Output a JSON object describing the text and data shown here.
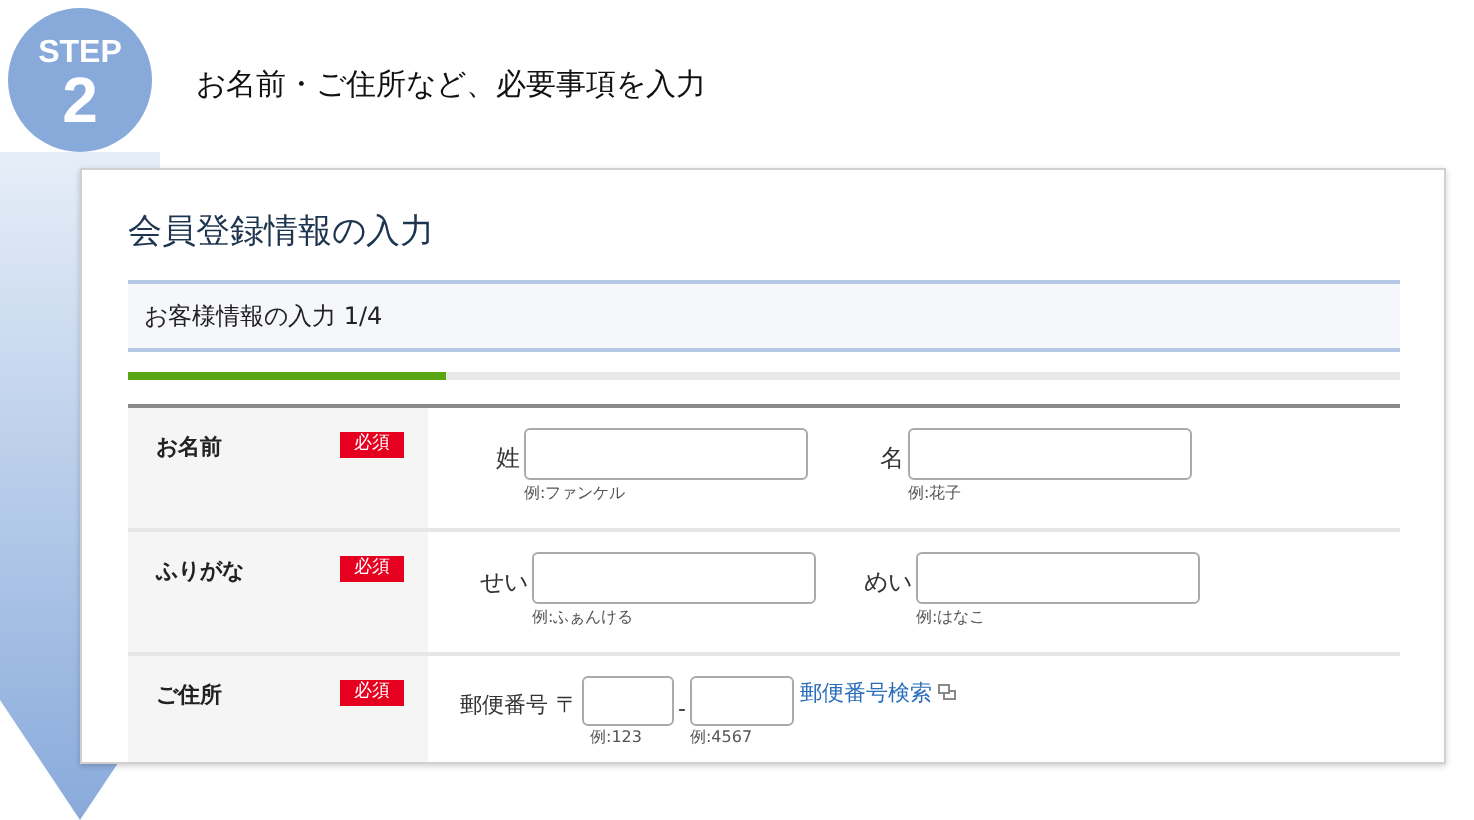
{
  "step": {
    "label": "STEP",
    "number": "2"
  },
  "heading": "お名前・ご住所など、必要事項を入力",
  "form": {
    "title": "会員登録情報の入力",
    "section": "お客様情報の入力 1/4",
    "progress": {
      "level": 0.25
    },
    "rows": [
      {
        "label": "お名前",
        "badge": "必須",
        "kind": "pair",
        "fields": [
          {
            "label": "姓",
            "hint": "例:ファンケル"
          },
          {
            "label": "名",
            "hint": "例:花子"
          }
        ]
      },
      {
        "label": "ふりがな",
        "badge": "必須",
        "kind": "pair",
        "fields": [
          {
            "label": "せい",
            "hint": "例:ふぁんける"
          },
          {
            "label": "めい",
            "hint": "例:はなこ"
          }
        ]
      },
      {
        "label": "ご住所",
        "badge": "必須",
        "kind": "postal",
        "postal_label": "郵便番号",
        "postal_mark": "〒",
        "separator": "-",
        "fields": [
          {
            "hint": "例:123"
          },
          {
            "hint": "例:4567"
          }
        ],
        "link": "郵便番号検索"
      }
    ]
  }
}
